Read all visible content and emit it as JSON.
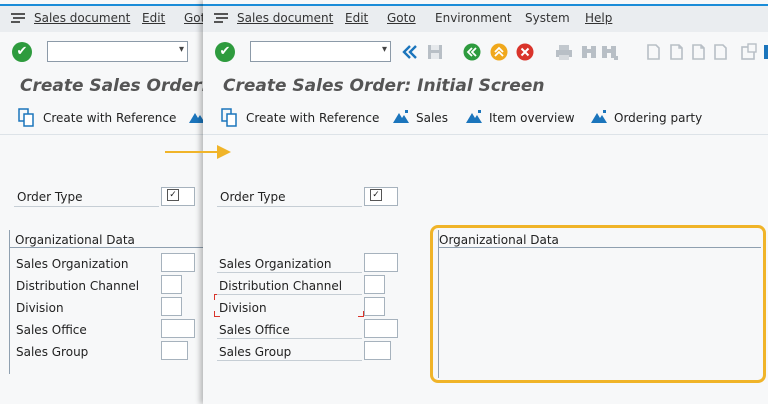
{
  "colors": {
    "accent": "#1a8cd8",
    "highlight": "#f0b429",
    "ok": "#2e9b3e",
    "required": "#d9342b"
  },
  "menu": [
    "Sales document",
    "Edit",
    "Goto",
    "Environment",
    "System",
    "Help"
  ],
  "back_window": {
    "menu": [
      "Sales document",
      "Edit",
      "Got"
    ],
    "title": "Create Sales Order: In",
    "create_ref": "Create with Reference",
    "order_type_label": "Order Type",
    "org_header": "Organizational Data",
    "fields": [
      "Sales Organization",
      "Distribution Channel",
      "Division",
      "Sales Office",
      "Sales Group"
    ]
  },
  "front_window": {
    "title": "Create Sales Order: Initial Screen",
    "app_toolbar": {
      "create_ref": "Create with Reference",
      "sales": "Sales",
      "item_overview": "Item overview",
      "ordering_party": "Ordering party"
    },
    "order_type_label": "Order Type",
    "fields": [
      "Sales Organization",
      "Distribution Channel",
      "Division",
      "Sales Office",
      "Sales Group"
    ],
    "org_panel_header": "Organizational Data"
  },
  "command_field": {
    "value": "",
    "placeholder": ""
  },
  "icons": [
    "menu-icon",
    "ok-icon",
    "dropdown-icon",
    "back-icon",
    "save-icon",
    "exit-icon",
    "up-icon",
    "cancel-icon",
    "print-icon",
    "find-icon",
    "first-page-icon",
    "prev-page-icon",
    "next-page-icon",
    "last-page-icon",
    "new-session-icon",
    "help-icon",
    "create-reference-icon",
    "mountain-icon"
  ]
}
